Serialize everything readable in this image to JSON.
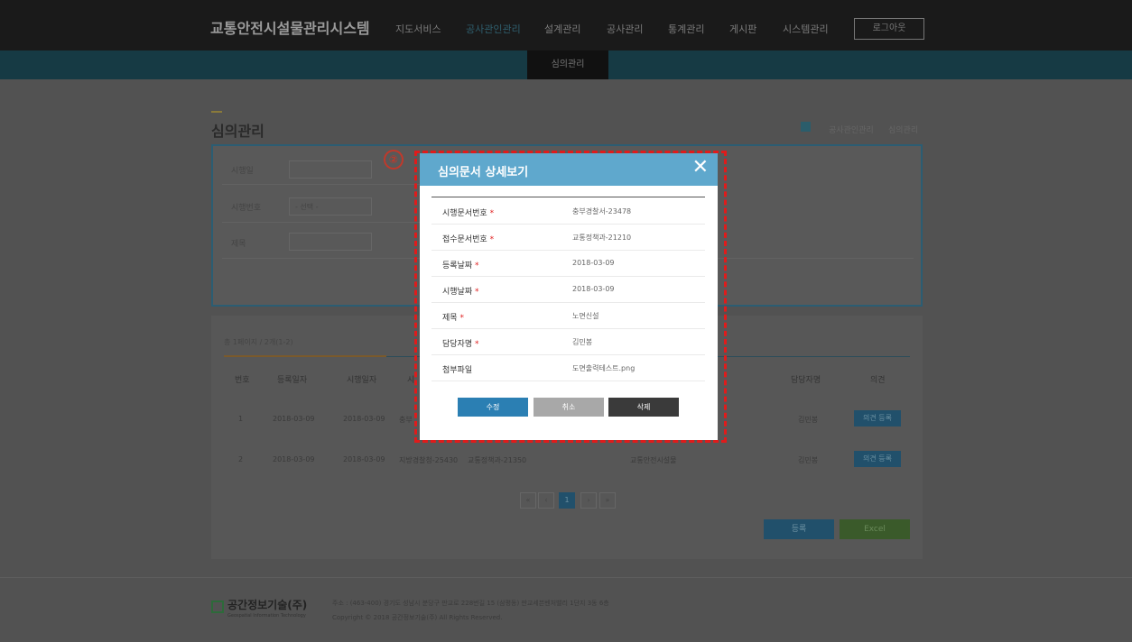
{
  "header": {
    "brand": "교통안전시설물관리시스템",
    "nav": [
      "지도서비스",
      "공사관인관리",
      "설계관리",
      "공사관리",
      "통계관리",
      "게시판",
      "시스템관리"
    ],
    "logout": "로그아웃",
    "sub_nav_active": "심의관리"
  },
  "page": {
    "title": "심의관리",
    "breadcrumb": [
      "공사관인관리",
      "심의관리"
    ]
  },
  "search": {
    "date_label": "시행일",
    "number_label": "시행번호",
    "number_select": "- 선택 -",
    "title_label": "제목"
  },
  "list": {
    "total": "총 1페이지 / 2개(1-2)",
    "columns": [
      "번호",
      "등록일자",
      "시행일자",
      "시",
      "담당자명",
      "의견"
    ],
    "rows": [
      {
        "no": "1",
        "reg_date": "2018-03-09",
        "exec_date": "2018-03-09",
        "doc": "충부",
        "manager": "김민봉",
        "action": "의견 등록"
      },
      {
        "no": "2",
        "reg_date": "2018-03-09",
        "exec_date": "2018-03-09",
        "doc": "지방경찰청-25430",
        "receipt": "교통정책과-21350",
        "title": "교통안전시설물",
        "manager": "김민봉",
        "action": "의견 등록"
      }
    ],
    "pager": {
      "first": "«",
      "prev": "‹",
      "current": "1",
      "next": "›",
      "last": "»"
    },
    "register": "등록",
    "excel": "Excel"
  },
  "footer": {
    "company": "공간정보기술(주)",
    "company_sub": "Geospatial Information Technology",
    "address": "주소 : (463-400) 경기도 성남시 분당구 판교로 228번길 15 (삼평동) 판교세븐벤처밸리 1단지 3동 6층",
    "copyright": "Copyright © 2018 공간정보기술(주) All Rights Reserved."
  },
  "annotation": {
    "number": "②"
  },
  "modal": {
    "title": "심의문서 상세보기",
    "close": "✕",
    "fields": [
      {
        "label": "시행문서번호",
        "required": "*",
        "value": "충부경찰서-23478"
      },
      {
        "label": "접수문서번호",
        "required": "*",
        "value": "교통정책과-21210"
      },
      {
        "label": "등록날짜",
        "required": "*",
        "value": "2018-03-09"
      },
      {
        "label": "시행날짜",
        "required": "*",
        "value": "2018-03-09"
      },
      {
        "label": "제목",
        "required": "*",
        "value": "노면신설"
      },
      {
        "label": "담당자명",
        "required": "*",
        "value": "김민봉"
      },
      {
        "label": "첨부파일",
        "required": "",
        "value": "도면출력테스트.png"
      }
    ],
    "buttons": {
      "edit": "수정",
      "cancel": "취소",
      "delete": "삭제"
    }
  },
  "colors": {
    "modal_header": "#5fa8cd",
    "highlight": "#e01b1b",
    "required": "#e02020",
    "edit_button": "#2b7fb3",
    "cancel_button": "#a8a8a8",
    "delete_button": "#3a3a3a"
  }
}
